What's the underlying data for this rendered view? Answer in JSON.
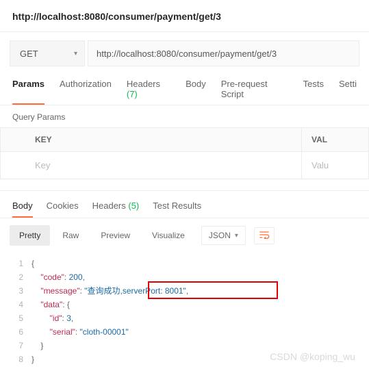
{
  "title_url": "http://localhost:8080/consumer/payment/get/3",
  "request": {
    "method": "GET",
    "url": "http://localhost:8080/consumer/payment/get/3"
  },
  "tabs": {
    "params": "Params",
    "auth": "Authorization",
    "headers": "Headers",
    "headers_count": "(7)",
    "body": "Body",
    "prerequest": "Pre-request Script",
    "tests": "Tests",
    "settings": "Setti"
  },
  "query_params_title": "Query Params",
  "param_table": {
    "key_header": "KEY",
    "value_header": "VAL",
    "key_placeholder": "Key",
    "value_placeholder": "Valu"
  },
  "resp_tabs": {
    "body": "Body",
    "cookies": "Cookies",
    "headers": "Headers",
    "headers_count": "(5)",
    "test_results": "Test Results"
  },
  "view_modes": {
    "pretty": "Pretty",
    "raw": "Raw",
    "preview": "Preview",
    "visualize": "Visualize",
    "format": "JSON"
  },
  "response_json": {
    "code": 200,
    "message": "查询成功,serverPort: 8001",
    "data": {
      "id": 3,
      "serial": "cloth-00001"
    }
  },
  "code_lines": {
    "l1": "{",
    "l2a": "\"code\"",
    "l2b": "200",
    "l3a": "\"message\"",
    "l3b": "\"查询成功,",
    "l3c": "serverPort: 8001\"",
    "l4a": "\"data\"",
    "l5a": "\"id\"",
    "l5b": "3",
    "l6a": "\"serial\"",
    "l6b": "\"cloth-00001\"",
    "l7": "}",
    "l8": "}"
  },
  "line_nums": [
    "1",
    "2",
    "3",
    "4",
    "5",
    "6",
    "7",
    "8"
  ],
  "watermark": "CSDN @koping_wu"
}
